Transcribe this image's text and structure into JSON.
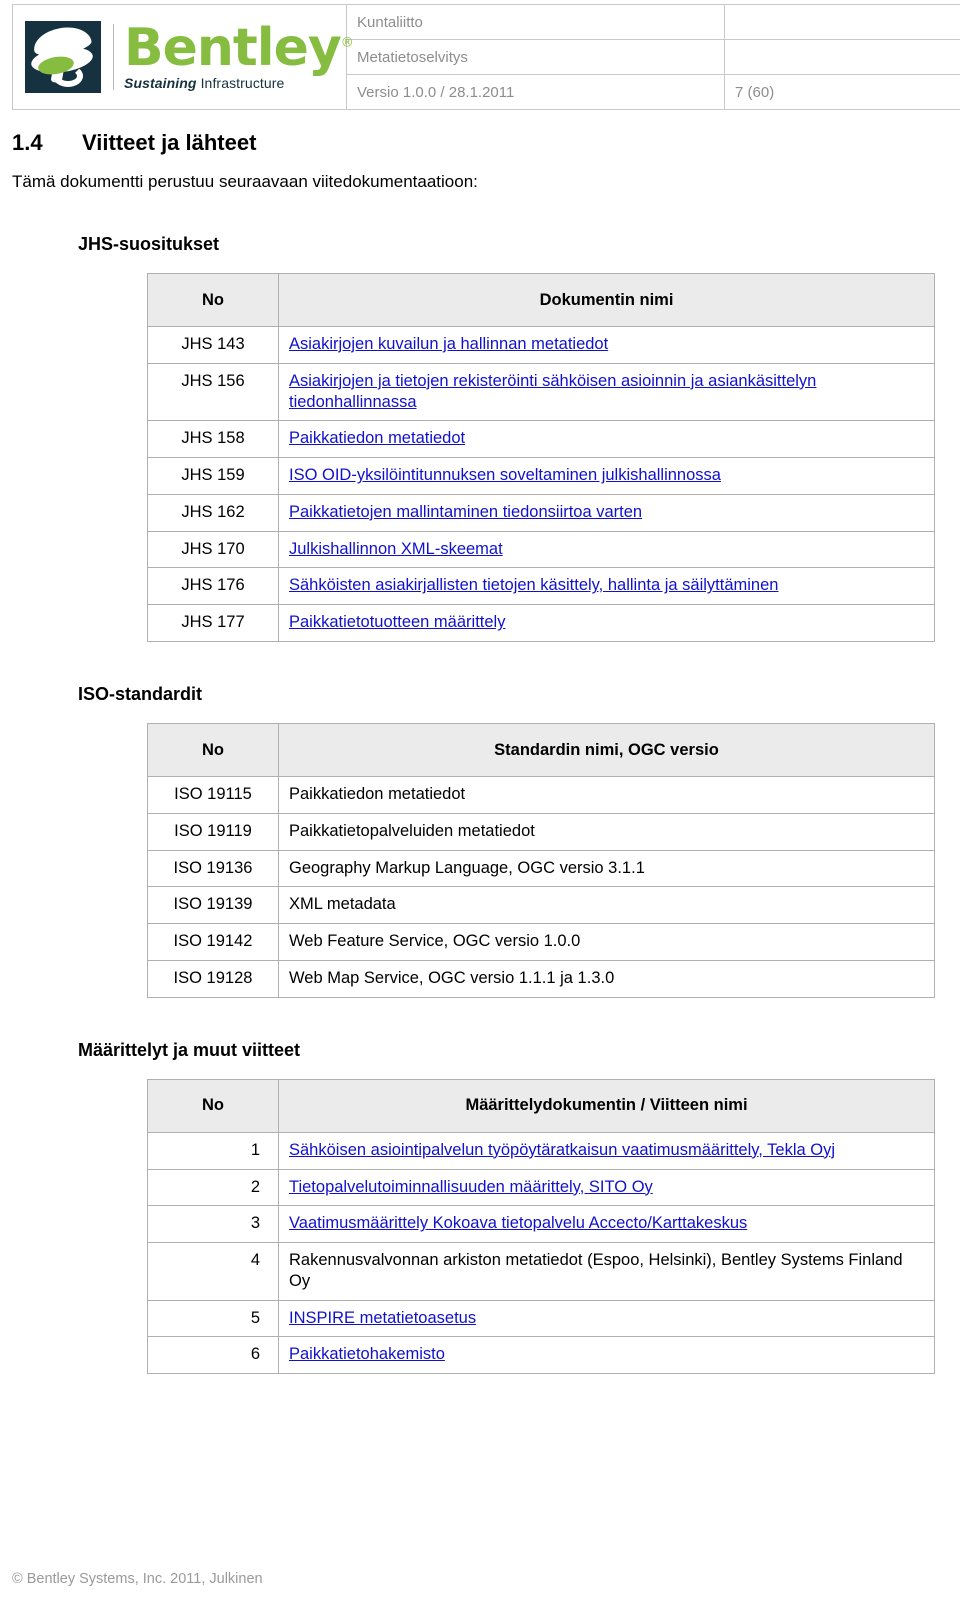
{
  "header": {
    "logo": {
      "word": "Bentley",
      "registered": "®",
      "tagline_bold": "Sustaining",
      "tagline_rest": "Infrastructure"
    },
    "rows": [
      {
        "doc": "Kuntaliitto",
        "page": ""
      },
      {
        "doc": "Metatietoselvitys",
        "page": ""
      },
      {
        "doc": "Versio 1.0.0 / 28.1.2011",
        "page": "7 (60)"
      }
    ]
  },
  "section": {
    "number": "1.4",
    "title": "Viitteet ja lähteet",
    "intro": "Tämä dokumentti perustuu seuraavaan viitedokumentaatioon:"
  },
  "jhs": {
    "heading": "JHS-suositukset",
    "columns": [
      "No",
      "Dokumentin nimi"
    ],
    "rows": [
      {
        "no": "JHS 143",
        "name": "Asiakirjojen kuvailun ja hallinnan metatiedot",
        "link": true
      },
      {
        "no": "JHS 156",
        "name": "Asiakirjojen ja tietojen rekisteröinti sähköisen asioinnin ja asiankäsittelyn tiedonhallinnassa",
        "link": true
      },
      {
        "no": "JHS 158",
        "name": "Paikkatiedon metatiedot",
        "link": true
      },
      {
        "no": "JHS 159",
        "name": "ISO OID-yksilöintitunnuksen soveltaminen julkishallinnossa",
        "link": true
      },
      {
        "no": "JHS 162",
        "name": "Paikkatietojen mallintaminen tiedonsiirtoa varten",
        "link": true
      },
      {
        "no": "JHS 170",
        "name": "Julkishallinnon XML-skeemat",
        "link": true
      },
      {
        "no": "JHS 176",
        "name": "Sähköisten asiakirjallisten tietojen käsittely, hallinta ja säilyttäminen",
        "link": true
      },
      {
        "no": "JHS 177",
        "name": "Paikkatietotuotteen määrittely",
        "link": true
      }
    ]
  },
  "iso": {
    "heading": "ISO-standardit",
    "columns": [
      "No",
      "Standardin nimi, OGC versio"
    ],
    "rows": [
      {
        "no": "ISO 19115",
        "name": "Paikkatiedon metatiedot",
        "link": false
      },
      {
        "no": "ISO 19119",
        "name": "Paikkatietopalveluiden metatiedot",
        "link": false
      },
      {
        "no": "ISO 19136",
        "name": "Geography Markup Language, OGC  versio 3.1.1",
        "link": false
      },
      {
        "no": "ISO 19139",
        "name": "XML metadata",
        "link": false
      },
      {
        "no": "ISO 19142",
        "name": "Web Feature Service, OGC versio 1.0.0",
        "link": false
      },
      {
        "no": "ISO 19128",
        "name": "Web Map Service, OGC versio 1.1.1 ja 1.3.0",
        "link": false
      }
    ]
  },
  "defs": {
    "heading": "Määrittelyt ja muut viitteet",
    "columns": [
      "No",
      "Määrittelydokumentin / Viitteen nimi"
    ],
    "rows": [
      {
        "no": "1",
        "name": "Sähköisen asiointipalvelun työpöytäratkaisun vaatimusmäärittely, Tekla Oyj",
        "link": true
      },
      {
        "no": "2",
        "name": "Tietopalvelutoiminnallisuuden määrittely, SITO Oy",
        "link": true
      },
      {
        "no": "3",
        "name": "Vaatimusmäärittely Kokoava tietopalvelu Accecto/Karttakeskus",
        "link": true
      },
      {
        "no": "4",
        "name": "Rakennusvalvonnan arkiston metatiedot (Espoo, Helsinki), Bentley Systems Finland Oy",
        "link": false
      },
      {
        "no": "5",
        "name": "INSPIRE metatietoasetus",
        "link": true
      },
      {
        "no": "6",
        "name": "Paikkatietohakemisto",
        "link": true
      }
    ]
  },
  "footer": {
    "copyright": "© Bentley Systems, Inc. 2011, Julkinen"
  },
  "colors": {
    "link": "#1111CC",
    "table_header_bg": "#EBEBEB",
    "border": "#B0B0B0",
    "logo_green": "#86BC40",
    "logo_dark": "#16313F",
    "muted_text": "#8D8D8D"
  }
}
